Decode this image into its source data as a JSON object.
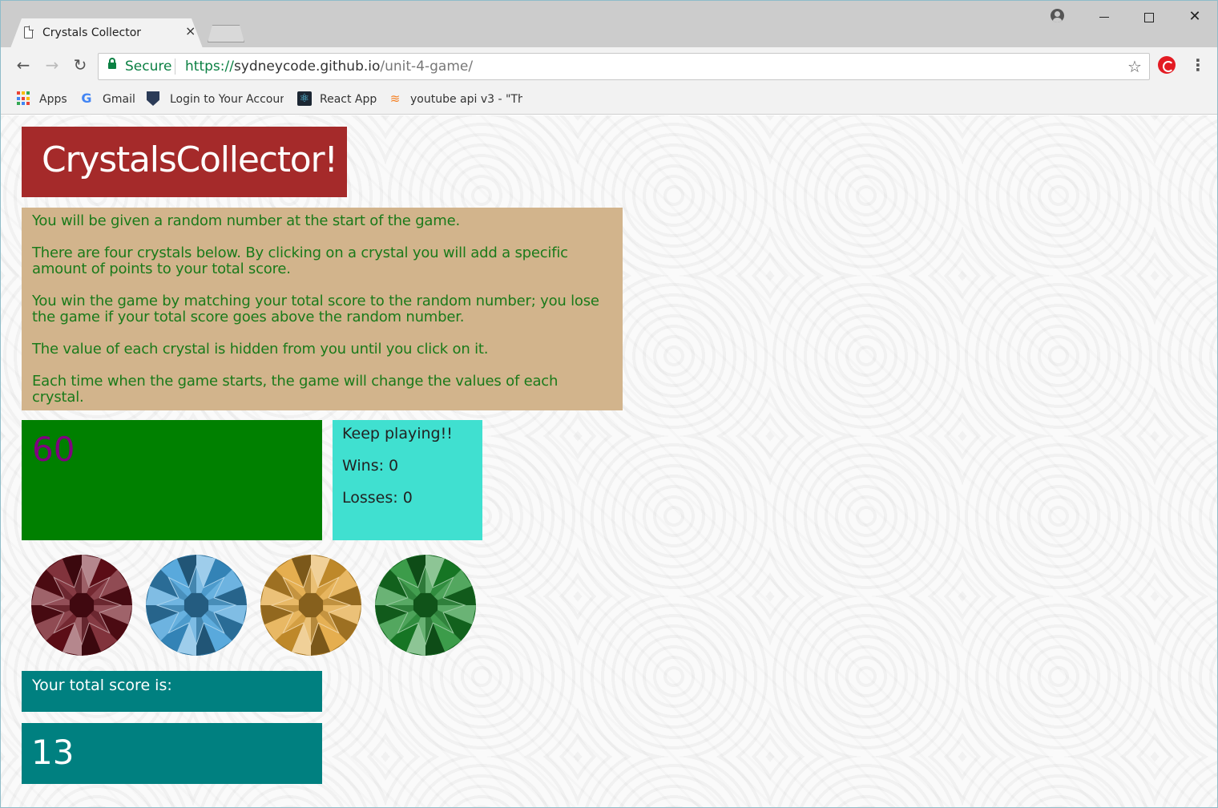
{
  "browser": {
    "tab_title": "Crystals Collector",
    "tab_close": "×",
    "secure_label": "Secure",
    "url_scheme": "https://",
    "url_host": "sydneycode.github.io",
    "url_path": "/unit-4-game/",
    "bookmarks": [
      {
        "label": "Apps",
        "icon": "apps-icon"
      },
      {
        "label": "Gmail",
        "icon": "google-icon"
      },
      {
        "label": "Login to Your Accoun",
        "icon": "shield-icon"
      },
      {
        "label": "React App",
        "icon": "react-icon"
      },
      {
        "label": "youtube api v3 - \"Thi",
        "icon": "stackoverflow-icon"
      }
    ],
    "colors": {
      "secure": "#0b8043",
      "chrome": "#f2f2f2",
      "titlebar": "#cccccc"
    }
  },
  "game": {
    "title": "CrystalsCollector!",
    "instructions": [
      "You will be given a random number at the start of the game.",
      "There are four crystals below. By clicking on a crystal you will add a specific amount of points to your total score.",
      "You win the game by matching your total score to the random number; you lose the game if your total score goes above the random number.",
      "The value of each crystal is hidden from you until you click on it.",
      "Each time when the game starts, the game will change the values of each crystal."
    ],
    "target_number": "60",
    "status": {
      "message": "Keep playing!!",
      "wins": "Wins: 0",
      "losses": "Losses: 0"
    },
    "crystals": [
      {
        "name": "red-crystal",
        "color": "#6b0f1a"
      },
      {
        "name": "blue-crystal",
        "color": "#3c9ad6"
      },
      {
        "name": "gold-crystal",
        "color": "#e0a030"
      },
      {
        "name": "green-crystal",
        "color": "#1a8a2a"
      }
    ],
    "score_label": "Your total score is:",
    "total_score": "13",
    "colors": {
      "heading_bg": "#a52a2a",
      "instructions_bg": "#d2b48c",
      "instructions_text": "#1a7a1a",
      "target_bg": "#008000",
      "target_text": "#800080",
      "status_bg": "#40e0d0",
      "score_bg": "#008080"
    }
  }
}
